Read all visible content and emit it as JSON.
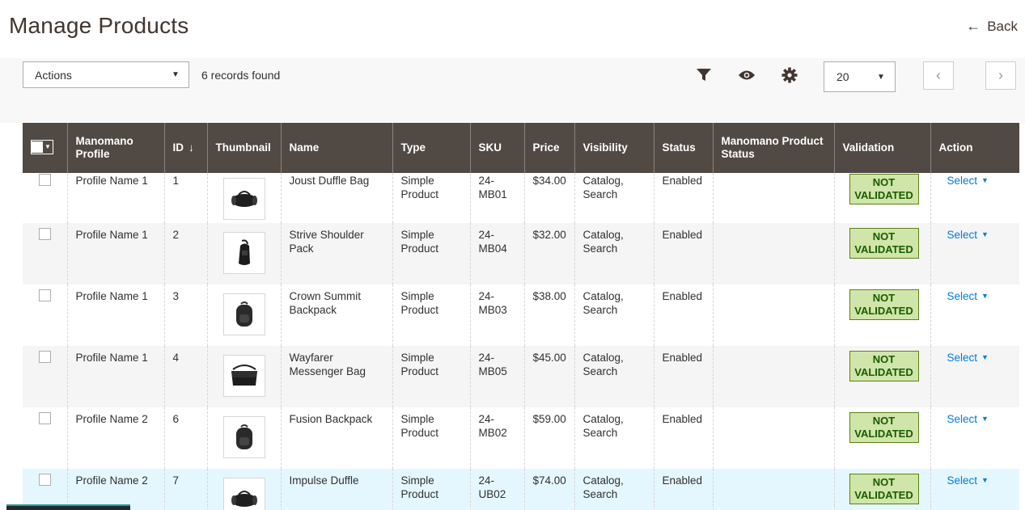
{
  "header": {
    "title": "Manage Products",
    "back_label": "Back",
    "back_icon": "arrow-left-icon"
  },
  "toolbar": {
    "actions_label": "Actions",
    "records_found": "6 records found",
    "icons": [
      "filter-icon",
      "eye-icon",
      "gear-icon"
    ],
    "per_page": "20",
    "prev_icon": "chevron-left-icon",
    "next_icon": "chevron-right-icon"
  },
  "table": {
    "columns": [
      "",
      "Manomano Profile",
      "ID",
      "Thumbnail",
      "Name",
      "Type",
      "SKU",
      "Price",
      "Visibility",
      "Status",
      "Manomano Product Status",
      "Validation",
      "Action"
    ],
    "sort_indicator": "↓",
    "rows": [
      {
        "profile": "Profile Name 1",
        "id": "1",
        "thumb": "duffle-bag-icon",
        "name": "Joust Duffle Bag",
        "type": "Simple Product",
        "sku": "24-MB01",
        "price": "$34.00",
        "visibility": "Catalog, Search",
        "status": "Enabled",
        "mm_status": "",
        "validation": "NOT VALIDATED",
        "action": "Select"
      },
      {
        "profile": "Profile Name 1",
        "id": "2",
        "thumb": "shoulder-pack-icon",
        "name": "Strive Shoulder Pack",
        "type": "Simple Product",
        "sku": "24-MB04",
        "price": "$32.00",
        "visibility": "Catalog, Search",
        "status": "Enabled",
        "mm_status": "",
        "validation": "NOT VALIDATED",
        "action": "Select"
      },
      {
        "profile": "Profile Name 1",
        "id": "3",
        "thumb": "backpack-icon",
        "name": "Crown Summit Backpack",
        "type": "Simple Product",
        "sku": "24-MB03",
        "price": "$38.00",
        "visibility": "Catalog, Search",
        "status": "Enabled",
        "mm_status": "",
        "validation": "NOT VALIDATED",
        "action": "Select"
      },
      {
        "profile": "Profile Name 1",
        "id": "4",
        "thumb": "messenger-bag-icon",
        "name": "Wayfarer Messenger Bag",
        "type": "Simple Product",
        "sku": "24-MB05",
        "price": "$45.00",
        "visibility": "Catalog, Search",
        "status": "Enabled",
        "mm_status": "",
        "validation": "NOT VALIDATED",
        "action": "Select"
      },
      {
        "profile": "Profile Name 2",
        "id": "6",
        "thumb": "backpack-icon",
        "name": "Fusion Backpack",
        "type": "Simple Product",
        "sku": "24-MB02",
        "price": "$59.00",
        "visibility": "Catalog, Search",
        "status": "Enabled",
        "mm_status": "",
        "validation": "NOT VALIDATED",
        "action": "Select"
      },
      {
        "profile": "Profile Name 2",
        "id": "7",
        "thumb": "duffle-bag-icon",
        "name": "Impulse Duffle",
        "type": "Simple Product",
        "sku": "24-UB02",
        "price": "$74.00",
        "visibility": "Catalog, Search",
        "status": "Enabled",
        "mm_status": "",
        "validation": "NOT VALIDATED",
        "action": "Select"
      }
    ]
  },
  "colors": {
    "header_bg": "#514943",
    "badge_bg": "#d0e5a9",
    "badge_text": "#185b00",
    "link": "#007bdb",
    "highlight_row": "#e5f7fe"
  }
}
